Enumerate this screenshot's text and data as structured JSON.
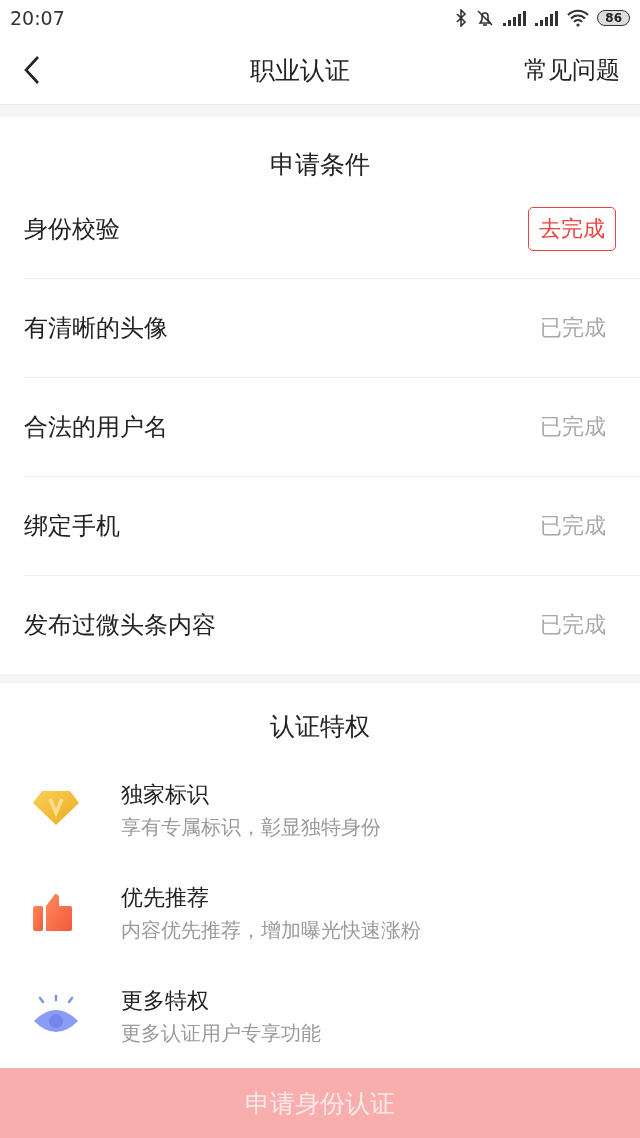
{
  "status_bar": {
    "time": "20:07",
    "battery": "86"
  },
  "nav": {
    "title": "职业认证",
    "action": "常见问题"
  },
  "conditions": {
    "title": "申请条件",
    "items": [
      {
        "label": "身份校验",
        "status": "去完成",
        "done": false
      },
      {
        "label": "有清晰的头像",
        "status": "已完成",
        "done": true
      },
      {
        "label": "合法的用户名",
        "status": "已完成",
        "done": true
      },
      {
        "label": "绑定手机",
        "status": "已完成",
        "done": true
      },
      {
        "label": "发布过微头条内容",
        "status": "已完成",
        "done": true
      }
    ]
  },
  "privileges": {
    "title": "认证特权",
    "items": [
      {
        "kind": "diamond",
        "title": "独家标识",
        "desc": "享有专属标识，彰显独特身份"
      },
      {
        "kind": "thumb",
        "title": "优先推荐",
        "desc": "内容优先推荐，增加曝光快速涨粉"
      },
      {
        "kind": "eye",
        "title": "更多特权",
        "desc": "更多认证用户专享功能"
      }
    ]
  },
  "submit": {
    "label": "申请身份认证",
    "disabled": true
  }
}
